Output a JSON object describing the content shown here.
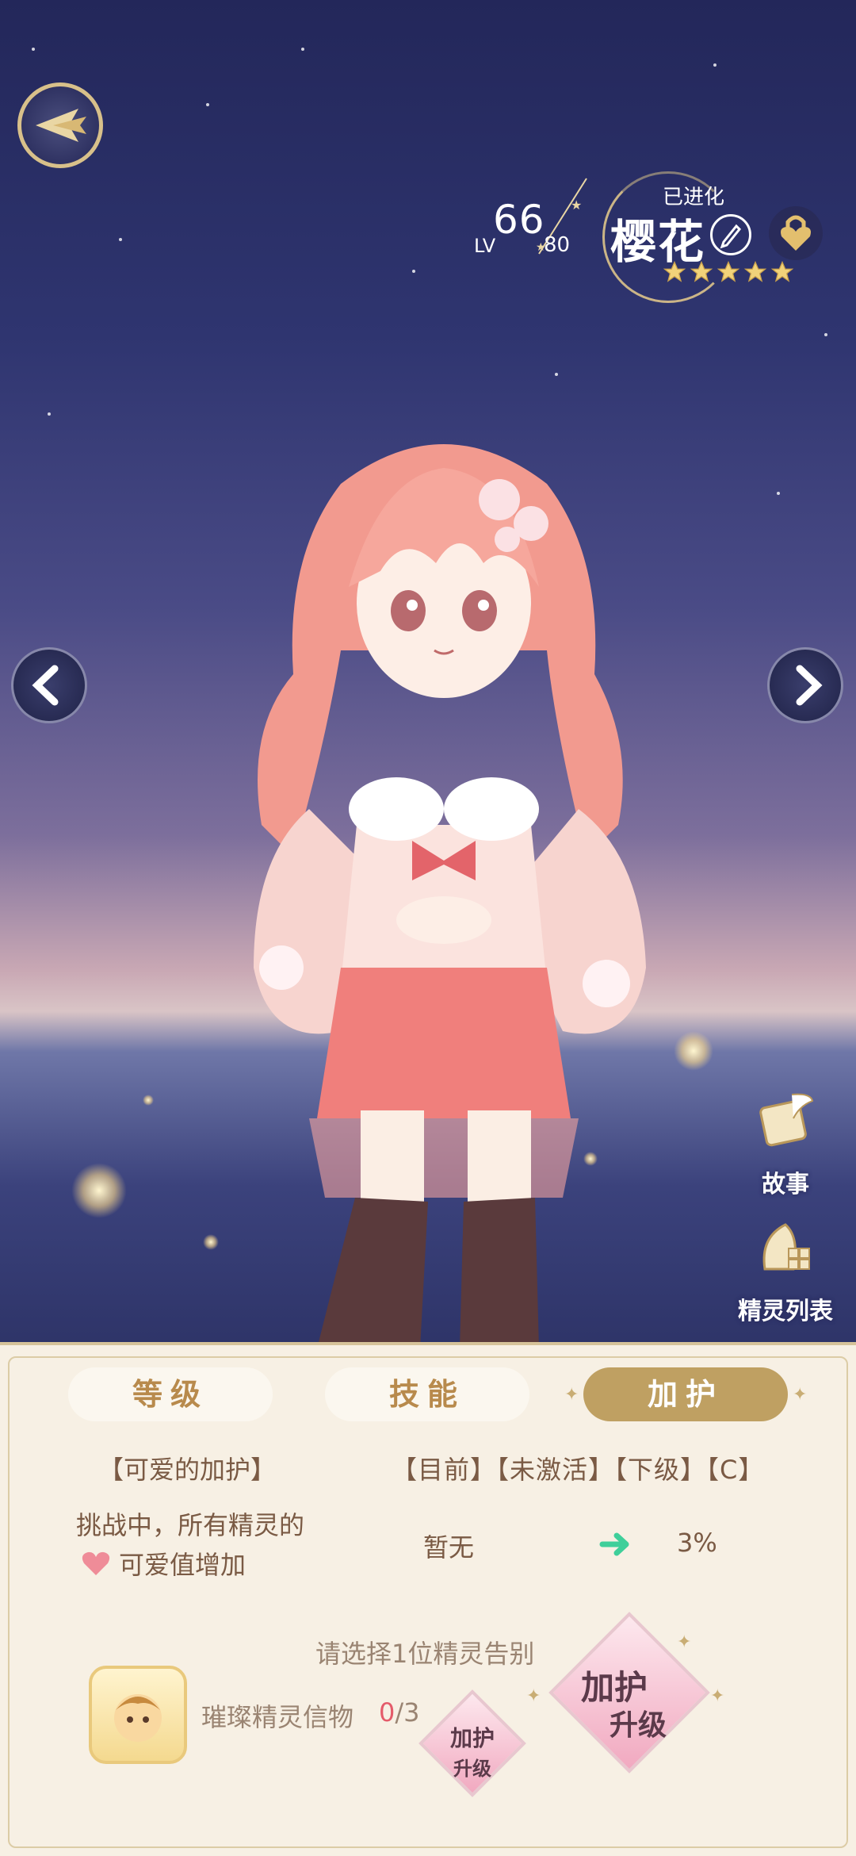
{
  "character": {
    "level": "66",
    "level_prefix": "LV",
    "level_max": "80",
    "evolved": "已进化",
    "name": "樱花",
    "stars": 5
  },
  "side_buttons": {
    "story": "故事",
    "list": "精灵列表"
  },
  "tabs": [
    {
      "label": "等级",
      "active": false
    },
    {
      "label": "技能",
      "active": false
    },
    {
      "label": "加护",
      "active": true
    }
  ],
  "blessing": {
    "title": "【可爱的加护】",
    "header": "【目前】【未激活】【下级】【C】",
    "desc_line1": "挑战中，所有精灵的",
    "desc_line2": "可爱值增加",
    "current": "暂无",
    "next": "3%",
    "select_prompt": "请选择1位精灵告别",
    "token_label": "璀璨精灵信物",
    "token_current": "0",
    "token_total": "/3",
    "upgrade_small_line1": "加护",
    "upgrade_small_line2": "升级",
    "upgrade_big_line1": "加护",
    "upgrade_big_line2": "升级"
  },
  "colors": {
    "accent_gold": "#bfa062",
    "panel_bg": "#f7f0e4",
    "text_brown": "#7a5a44",
    "token_count_red": "#e45b6a",
    "arrow_green": "#3fcf9a"
  }
}
